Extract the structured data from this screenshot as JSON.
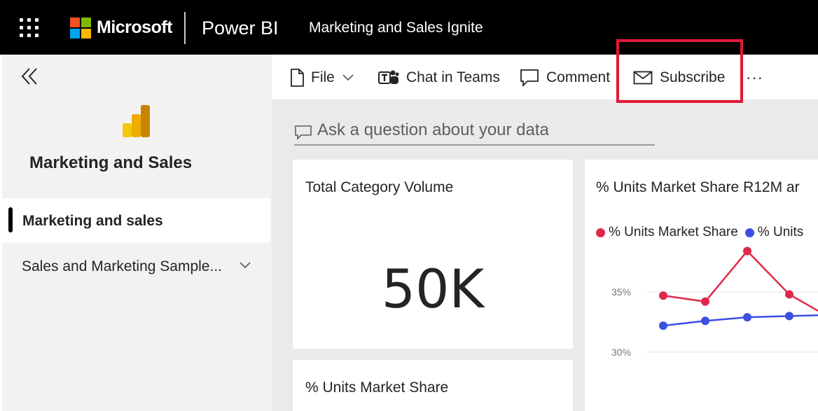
{
  "header": {
    "brand": "Microsoft",
    "product": "Power BI",
    "report_title": "Marketing and Sales Ignite"
  },
  "nav": {
    "workspace_title": "Marketing and Sales",
    "items": [
      {
        "label": "Marketing and sales",
        "active": true
      },
      {
        "label": "Sales and Marketing Sample...",
        "active": false
      }
    ]
  },
  "actions": {
    "file": "File",
    "chat": "Chat in Teams",
    "comment": "Comment",
    "subscribe": "Subscribe",
    "more": "···"
  },
  "qna": {
    "placeholder": "Ask a question about your data"
  },
  "tiles": {
    "total_volume": {
      "title": "Total Category Volume",
      "value": "50K"
    },
    "market_share_chart": {
      "title": "% Units Market Share R12M ar"
    },
    "market_share": {
      "title": "% Units Market Share"
    }
  },
  "colors": {
    "accent_red": "#e31937",
    "series_red": "#e0284a",
    "series_blue": "#3b4fe0"
  },
  "chart_data": {
    "type": "line",
    "title": "% Units Market Share R12M ar",
    "x": [
      1,
      2,
      3,
      4,
      5
    ],
    "series": [
      {
        "name": "% Units Market Share",
        "values": [
          34.7,
          34.2,
          38.4,
          34.8,
          32.8
        ]
      },
      {
        "name": "% Units",
        "values": [
          32.2,
          32.6,
          32.9,
          33.0,
          33.1
        ]
      }
    ],
    "yticks": [
      {
        "value": 35,
        "label": "35%"
      },
      {
        "value": 30,
        "label": "30%"
      }
    ],
    "ylim": [
      29,
      39
    ],
    "grid": true,
    "legend": "top-left"
  }
}
